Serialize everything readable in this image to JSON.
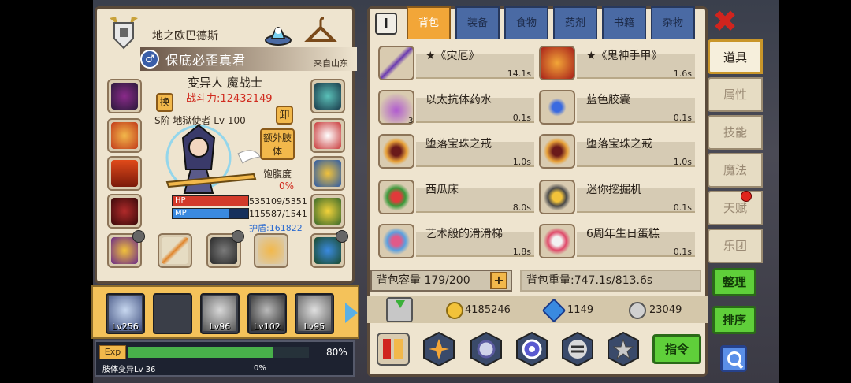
{
  "character": {
    "name": "地之欧巴德斯",
    "title": "保底必歪真君",
    "title_badge": "♂",
    "origin": "来自山东",
    "class": "变异人 魔战士",
    "combat_power": "战斗力:12432149",
    "swap_label": "换",
    "unequip_label": "卸",
    "rank": "S阶 地狱使者 Lv 100",
    "extra_limb_label": "额外肢体",
    "satiety_label": "饱腹度",
    "satiety_value": "0%",
    "hp_label": "HP",
    "hp_value": "535109/5351",
    "hp_fill": 1.0,
    "mp_label": "MP",
    "mp_value": "115587/1541",
    "mp_fill": 0.75,
    "shield": "护盾:161822"
  },
  "party": [
    {
      "level": "Lv256"
    },
    {
      "level": ""
    },
    {
      "level": "Lv96"
    },
    {
      "level": "Lv102"
    },
    {
      "level": "Lv95"
    }
  ],
  "exp": {
    "label": "Exp",
    "percent": "80%",
    "fill": 0.8,
    "evolution": "肢体变异Lv 36",
    "evolution_percent": "0%"
  },
  "inventory": {
    "tabs": [
      "背包",
      "装备",
      "食物",
      "药剂",
      "书籍",
      "杂物"
    ],
    "active_tab": "背包",
    "items": [
      {
        "name": "★《灾厄》",
        "weight": "14.1s",
        "count": ""
      },
      {
        "name": "★《鬼神手甲》",
        "weight": "1.6s",
        "count": ""
      },
      {
        "name": "以太抗体药水",
        "weight": "0.1s",
        "count": "3"
      },
      {
        "name": "蓝色胶囊",
        "weight": "0.1s",
        "count": ""
      },
      {
        "name": "堕落宝珠之戒",
        "weight": "1.0s",
        "count": ""
      },
      {
        "name": "堕落宝珠之戒",
        "weight": "1.0s",
        "count": ""
      },
      {
        "name": "西瓜床",
        "weight": "8.0s",
        "count": ""
      },
      {
        "name": "迷你挖掘机",
        "weight": "0.1s",
        "count": ""
      },
      {
        "name": "艺术般的滑滑梯",
        "weight": "1.8s",
        "count": ""
      },
      {
        "name": "6周年生日蛋糕",
        "weight": "0.1s",
        "count": ""
      }
    ],
    "capacity": "背包容量 179/200",
    "weight": "背包重量:747.1s/813.6s",
    "capacity_plus": "+"
  },
  "currency": {
    "gold": "4185246",
    "diamond": "1149",
    "silver": "23049"
  },
  "command_label": "指令",
  "info_label": "i",
  "close_label": "✖",
  "side_menu": [
    {
      "label": "道具",
      "active": true
    },
    {
      "label": "属性",
      "active": false
    },
    {
      "label": "技能",
      "active": false
    },
    {
      "label": "魔法",
      "active": false
    },
    {
      "label": "天赋",
      "active": false
    },
    {
      "label": "乐团",
      "active": false
    }
  ],
  "side_buttons": {
    "organize": "整理",
    "sort": "排序"
  },
  "colors": {
    "accent": "#f2a638",
    "tab": "#4a6aa4",
    "green": "#5fcf3a",
    "panel": "#eee4cf"
  }
}
